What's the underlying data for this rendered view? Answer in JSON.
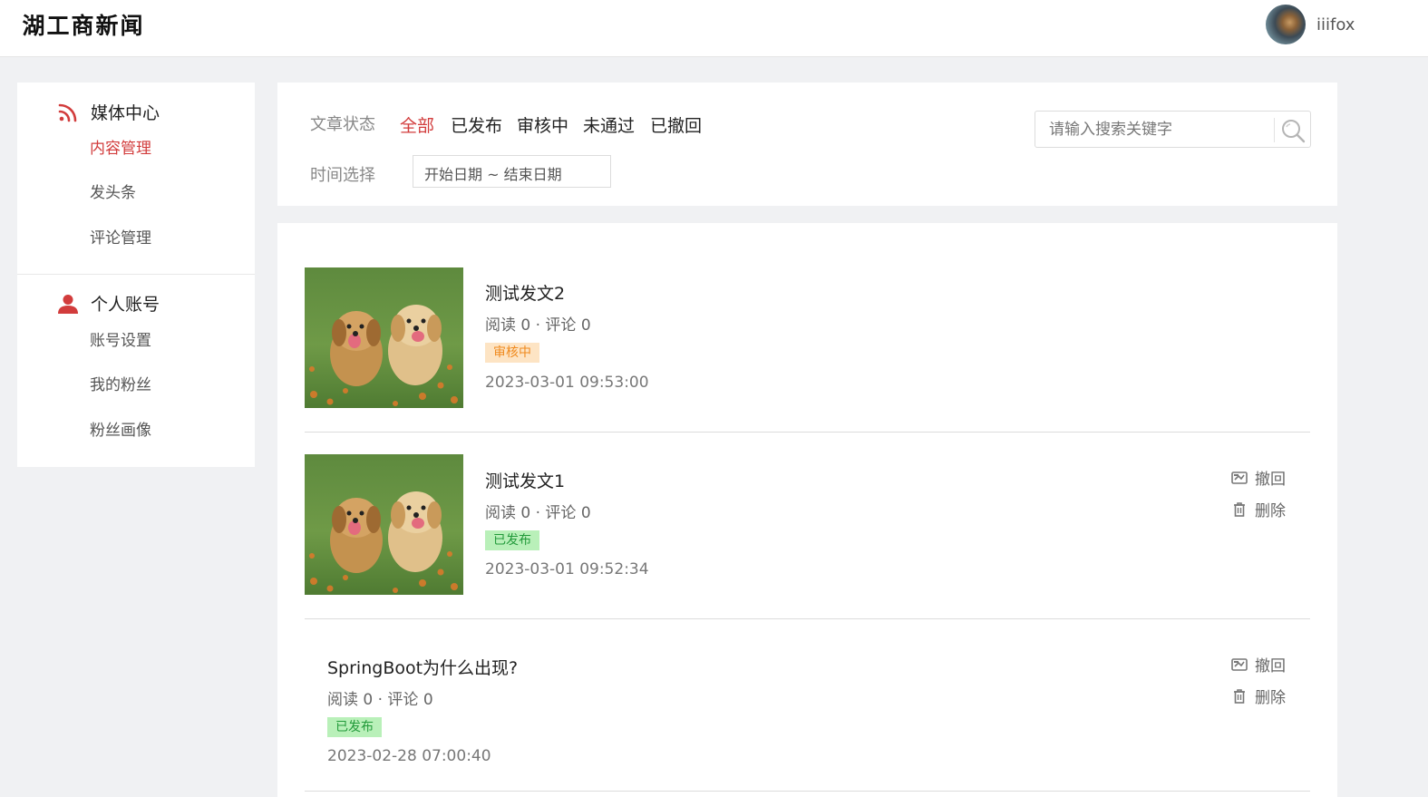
{
  "header": {
    "logo_text": "湖工商新闻",
    "username": "iiifox"
  },
  "sidebar": {
    "groups": [
      {
        "title": "媒体中心",
        "icon": "rss-icon",
        "items": [
          {
            "label": "内容管理",
            "active": true
          },
          {
            "label": "发头条",
            "active": false
          },
          {
            "label": "评论管理",
            "active": false
          }
        ]
      },
      {
        "title": "个人账号",
        "icon": "user-icon",
        "items": [
          {
            "label": "账号设置",
            "active": false
          },
          {
            "label": "我的粉丝",
            "active": false
          },
          {
            "label": "粉丝画像",
            "active": false
          }
        ]
      }
    ]
  },
  "filter": {
    "status_label": "文章状态",
    "tabs": [
      {
        "label": "全部",
        "active": true
      },
      {
        "label": "已发布",
        "active": false
      },
      {
        "label": "审核中",
        "active": false
      },
      {
        "label": "未通过",
        "active": false
      },
      {
        "label": "已撤回",
        "active": false
      }
    ],
    "time_label": "时间选择",
    "date_range_placeholder": "开始日期 ~ 结束日期",
    "search_placeholder": "请输入搜索关键字"
  },
  "articles": [
    {
      "title": "测试发文2",
      "meta": "阅读 0 · 评论 0",
      "status": "审核中",
      "date": "2023-03-01 09:53:00",
      "has_image": true,
      "actions": []
    },
    {
      "title": "测试发文1",
      "meta": "阅读 0 · 评论 0",
      "status": "已发布",
      "date": "2023-03-01 09:52:34",
      "has_image": true,
      "actions": [
        "撤回",
        "删除"
      ]
    },
    {
      "title": "SpringBoot为什么出现?",
      "meta": "阅读 0 · 评论 0",
      "status": "已发布",
      "date": "2023-02-28 07:00:40",
      "has_image": false,
      "actions": [
        "撤回",
        "删除"
      ]
    }
  ],
  "colors": {
    "accent": "#d23c3c",
    "review_bg": "#fde4c4",
    "review_text": "#f08a1e",
    "published_bg": "#b9f0b9",
    "published_text": "#229a3a"
  }
}
